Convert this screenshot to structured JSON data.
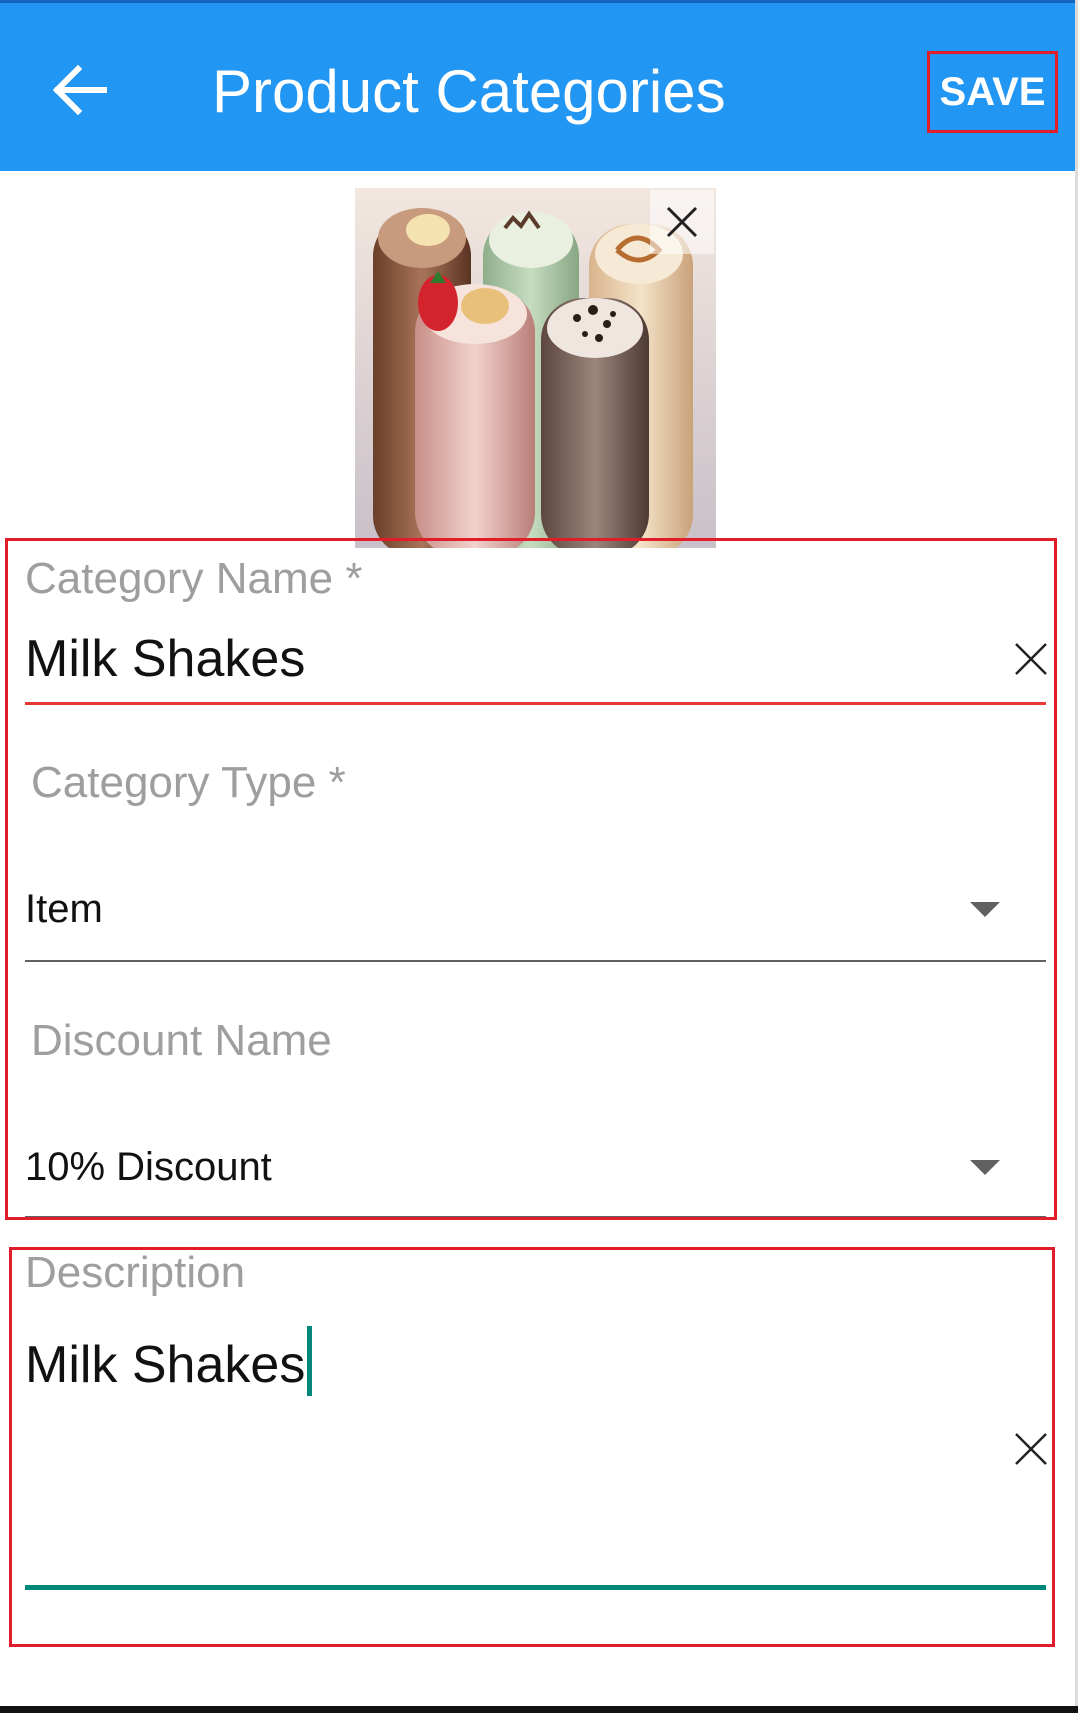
{
  "app_bar": {
    "title": "Product Categories",
    "save_label": "SAVE",
    "back_icon": "arrow-left-icon"
  },
  "image": {
    "description_icon": "milkshake-photo",
    "remove_icon": "close-icon"
  },
  "form": {
    "category_name": {
      "label": "Category Name *",
      "value": "Milk Shakes"
    },
    "category_type": {
      "label": "Category Type *",
      "value": "Item"
    },
    "discount_name": {
      "label": "Discount Name",
      "value": "10% Discount"
    },
    "description": {
      "label": "Description",
      "value": "Milk Shakes"
    }
  },
  "colors": {
    "app_bar": "#2196F3",
    "error_underline": "#E53935",
    "focus_underline": "#00897B",
    "annotation": "#E11D2A"
  }
}
